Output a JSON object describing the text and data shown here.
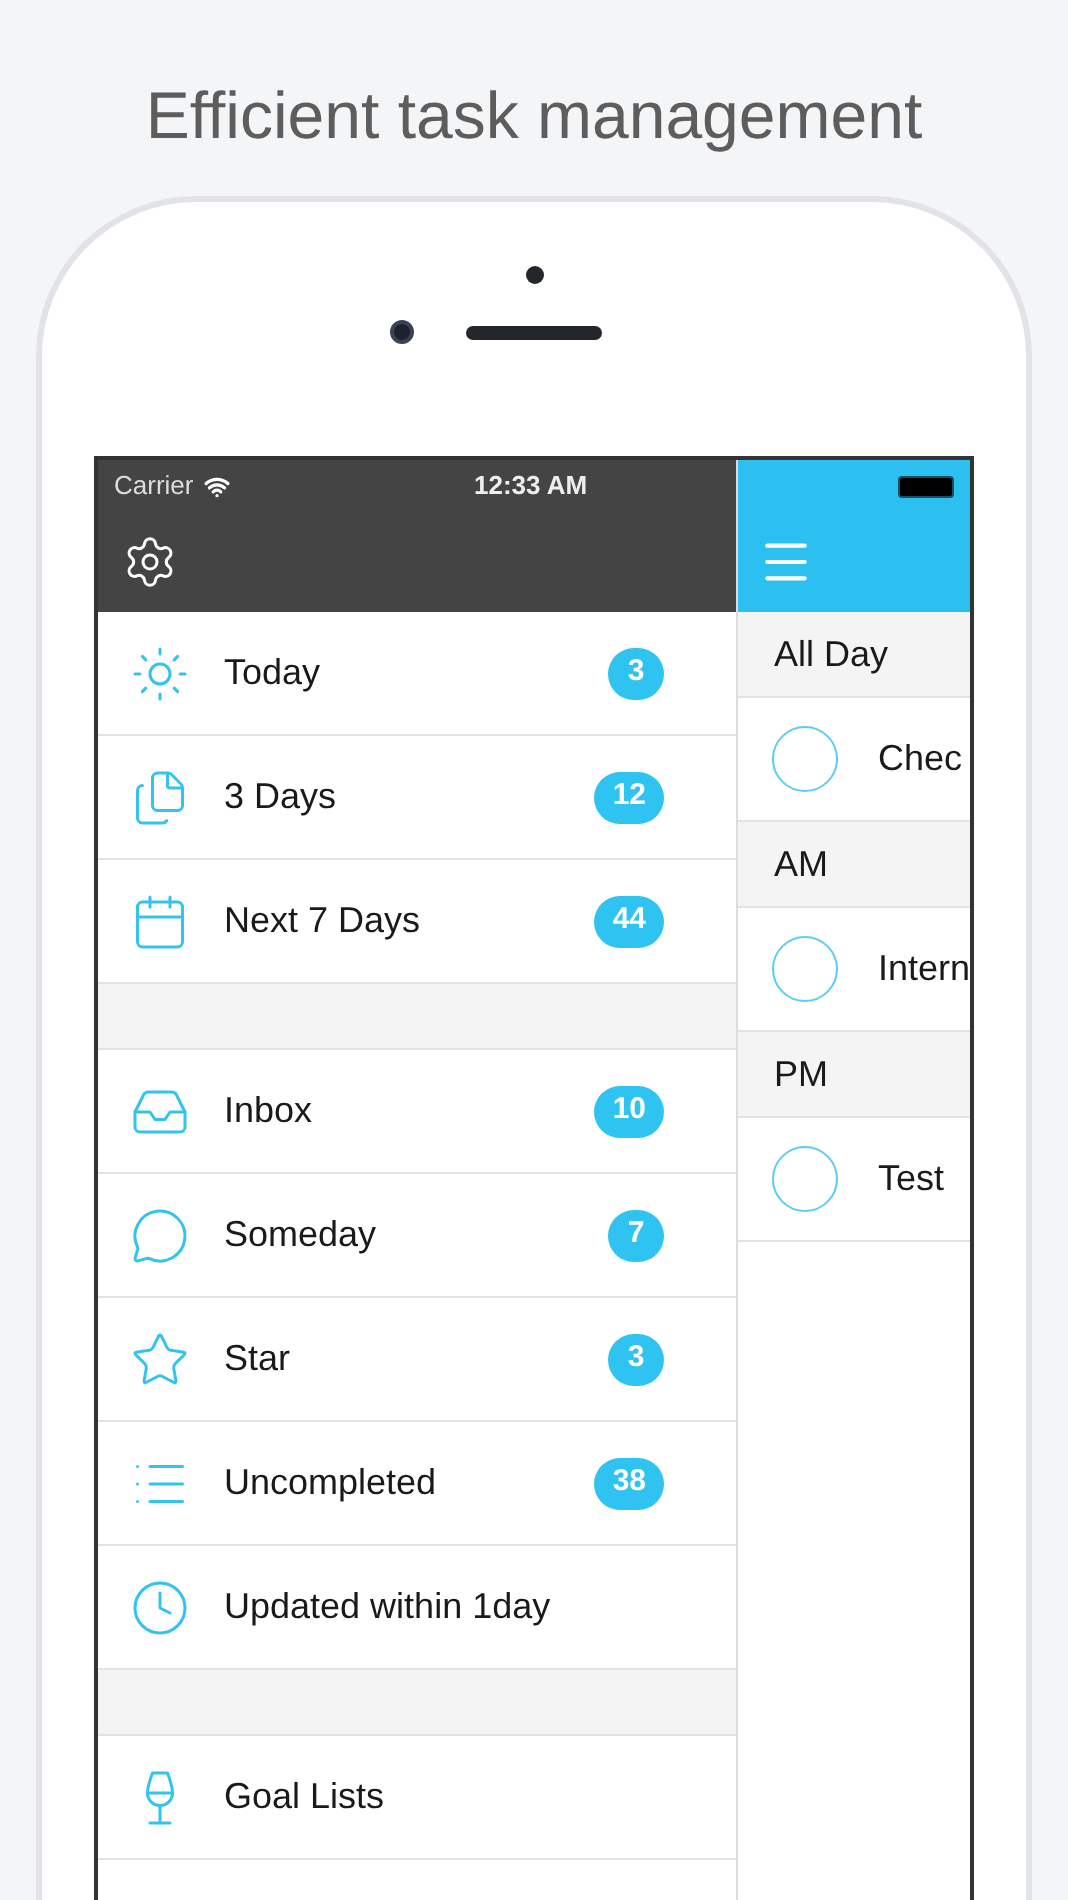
{
  "headline": "Efficient task management",
  "status_bar": {
    "carrier": "Carrier",
    "time": "12:33 AM"
  },
  "menu": {
    "sections": [
      {
        "items": [
          {
            "label": "Today",
            "badge": "3"
          },
          {
            "label": "3 Days",
            "badge": "12"
          },
          {
            "label": "Next 7 Days",
            "badge": "44"
          }
        ]
      },
      {
        "items": [
          {
            "label": "Inbox",
            "badge": "10"
          },
          {
            "label": "Someday",
            "badge": "7"
          },
          {
            "label": "Star",
            "badge": "3"
          },
          {
            "label": "Uncompleted",
            "badge": "38"
          },
          {
            "label": "Updated within 1day"
          }
        ]
      },
      {
        "items": [
          {
            "label": "Goal Lists"
          }
        ]
      }
    ]
  },
  "tasks": {
    "groups": [
      {
        "title": "All Day",
        "tasks": [
          {
            "title": "Chec",
            "checked": false
          }
        ]
      },
      {
        "title": "AM",
        "tasks": [
          {
            "title": "Intern",
            "checked": false
          }
        ]
      },
      {
        "title": "PM",
        "tasks": [
          {
            "title": "Test",
            "checked": false
          }
        ]
      }
    ]
  }
}
